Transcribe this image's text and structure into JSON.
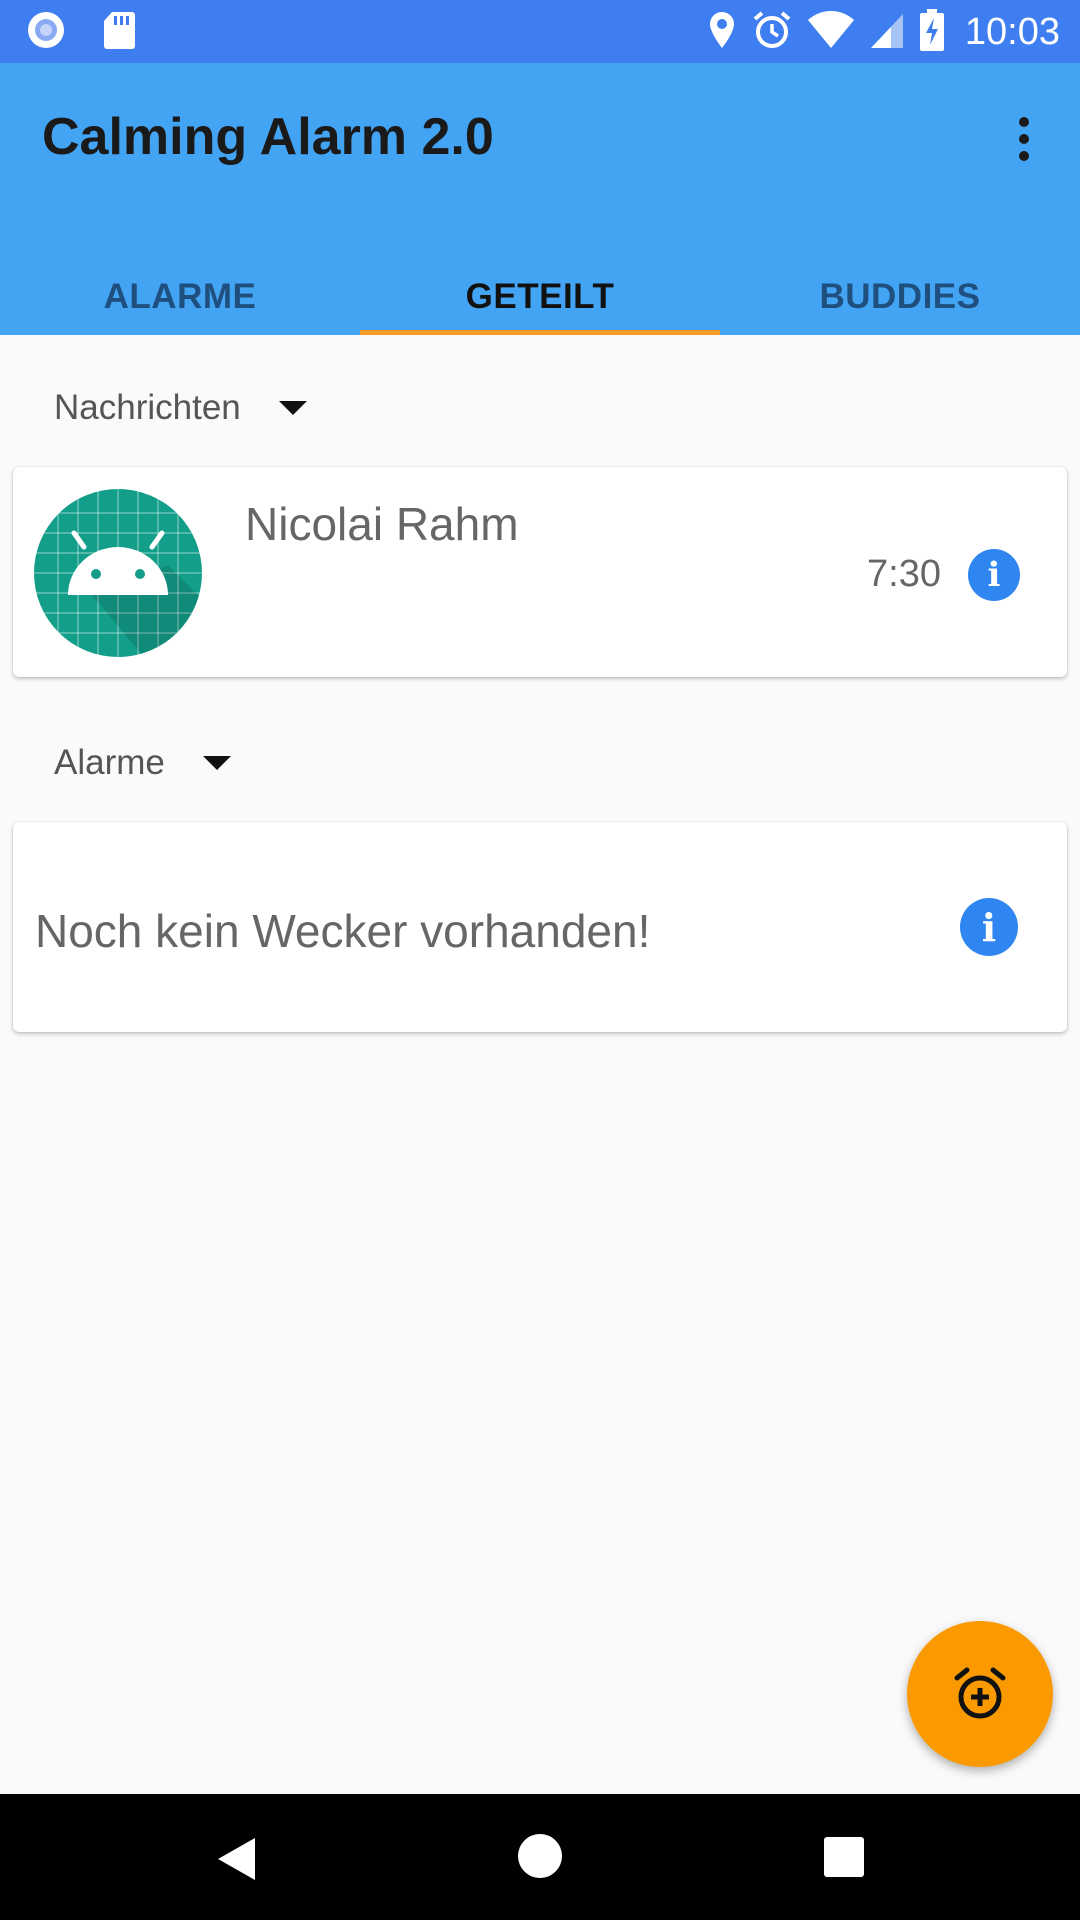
{
  "status_bar": {
    "time": "10:03",
    "icons": [
      "record-icon",
      "sd-card-icon",
      "location-icon",
      "alarm-icon",
      "wifi-icon",
      "signal-icon",
      "battery-charging-icon"
    ]
  },
  "app_bar": {
    "title": "Calming Alarm 2.0",
    "overflow_icon": "more-vert-icon"
  },
  "tabs": [
    {
      "label": "ALARME",
      "active": false
    },
    {
      "label": "GETEILT",
      "active": true
    },
    {
      "label": "BUDDIES",
      "active": false
    }
  ],
  "messages_section": {
    "header": "Nachrichten",
    "items": [
      {
        "name": "Nicolai Rahm",
        "time": "7:30",
        "avatar": "android-icon"
      }
    ]
  },
  "alarms_section": {
    "header": "Alarme",
    "empty_text": "Noch kein Wecker vorhanden!"
  },
  "fab": {
    "icon": "alarm-add-icon"
  },
  "colors": {
    "status_bar": "#3f7ef0",
    "app_bar": "#44a4f4",
    "tab_indicator": "#f59a23",
    "info_button": "#2f86f0",
    "fab": "#fb9a00",
    "avatar_bg": "#139e8a"
  }
}
